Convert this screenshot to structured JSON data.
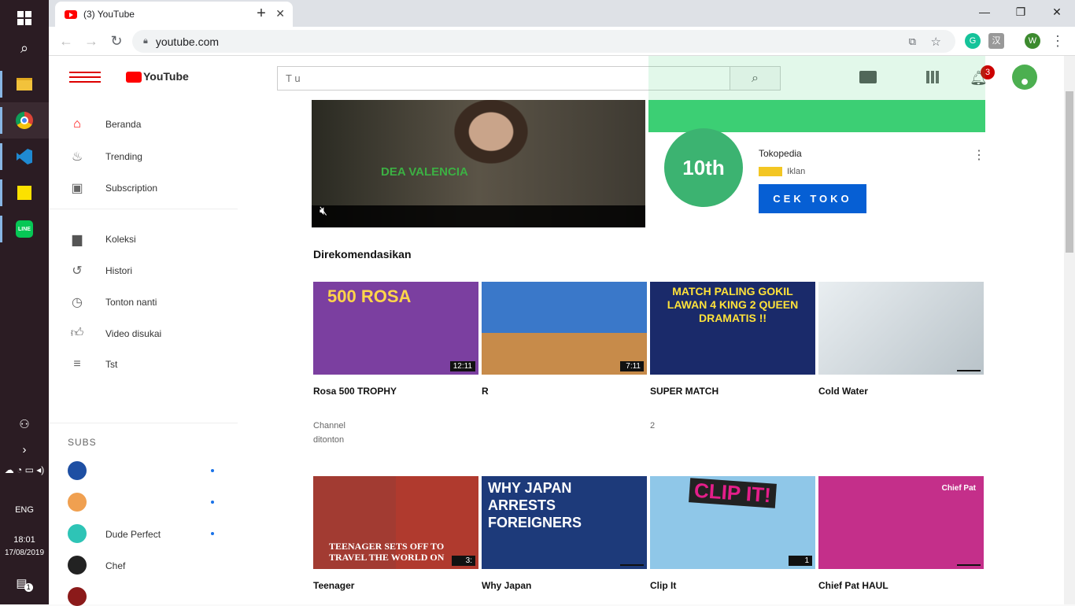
{
  "taskbar": {
    "lang": "ENG",
    "time": "18:01",
    "date": "17/08/2019",
    "notif_count": "1"
  },
  "browser": {
    "tab_title": "(3) YouTube",
    "url": "youtube.com",
    "profile_letter": "W"
  },
  "youtube": {
    "search_placeholder": "T u",
    "notifications": "3",
    "logo_text": "YouTube"
  },
  "sidebar": {
    "items": [
      {
        "label": "Beranda",
        "icon": "home-icon"
      },
      {
        "label": "Trending",
        "icon": "trending-icon"
      },
      {
        "label": "Subscription",
        "icon": "subscriptions-icon"
      },
      {
        "label": "Koleksi",
        "icon": "library-icon"
      },
      {
        "label": "Histori",
        "icon": "history-icon"
      },
      {
        "label": "Tonton nanti",
        "icon": "watch-later-icon"
      },
      {
        "label": "Video disukai",
        "icon": "liked-icon"
      },
      {
        "label": "Tst",
        "icon": "playlist-icon"
      }
    ],
    "subs_title": "SUBS",
    "subs": [
      {
        "name": "",
        "color": "#1e4fa3"
      },
      {
        "name": "",
        "color": "#f0a050"
      },
      {
        "name": "Dude Perfect",
        "color": "#2ec4b6"
      },
      {
        "name": "Chef",
        "color": "#222222"
      },
      {
        "name": "",
        "color": "#8b1a1a"
      }
    ]
  },
  "ad": {
    "video_label": "DEA VALENCIA",
    "logo_text": "10th",
    "title": "Tokopedia",
    "sub": "Iklan",
    "cta": "CEK TOKO"
  },
  "section": {
    "title": "Direkomendasikan"
  },
  "videos_row1": [
    {
      "thumb_text": "500 ROSA",
      "title": "Rosa 500 TROPHY",
      "meta1": "Channel",
      "meta2": "ditonton",
      "duration": "12:11",
      "bg": "#7b3fa0"
    },
    {
      "thumb_text": "",
      "title": "R",
      "meta1": "",
      "meta2": "",
      "duration": "7:11",
      "bg": "#3a78c9"
    },
    {
      "thumb_text": "MATCH PALING GOKIL LAWAN 4 KING 2 QUEEN DRAMATIS !!",
      "title": "SUPER MATCH",
      "meta1": "",
      "meta2": "2",
      "duration": "",
      "bg": "#1a2a6a"
    },
    {
      "thumb_text": "",
      "title": "Cold Water",
      "meta1": "",
      "meta2": "",
      "duration": "",
      "bg": "#c9ccd1"
    }
  ],
  "videos_row2": [
    {
      "thumb_text": "TEENAGER SETS OFF TO TRAVEL THE WORLD ON",
      "title": "Teenager",
      "meta1": "",
      "duration": "3:",
      "bg": "#b0342a"
    },
    {
      "thumb_text": "WHY JAPAN ARRESTS FOREIGNERS",
      "title": "Why Japan",
      "meta1": "",
      "duration": "",
      "bg": "#1d3a7a"
    },
    {
      "thumb_text": "CLIP IT!",
      "title": "Clip It",
      "meta1": "",
      "duration": "1",
      "bg": "#8fc7e8"
    },
    {
      "thumb_text": "Chief Pat",
      "title": "Chief Pat HAUL",
      "meta1": "",
      "duration": "",
      "bg": "#c42f8a"
    }
  ]
}
